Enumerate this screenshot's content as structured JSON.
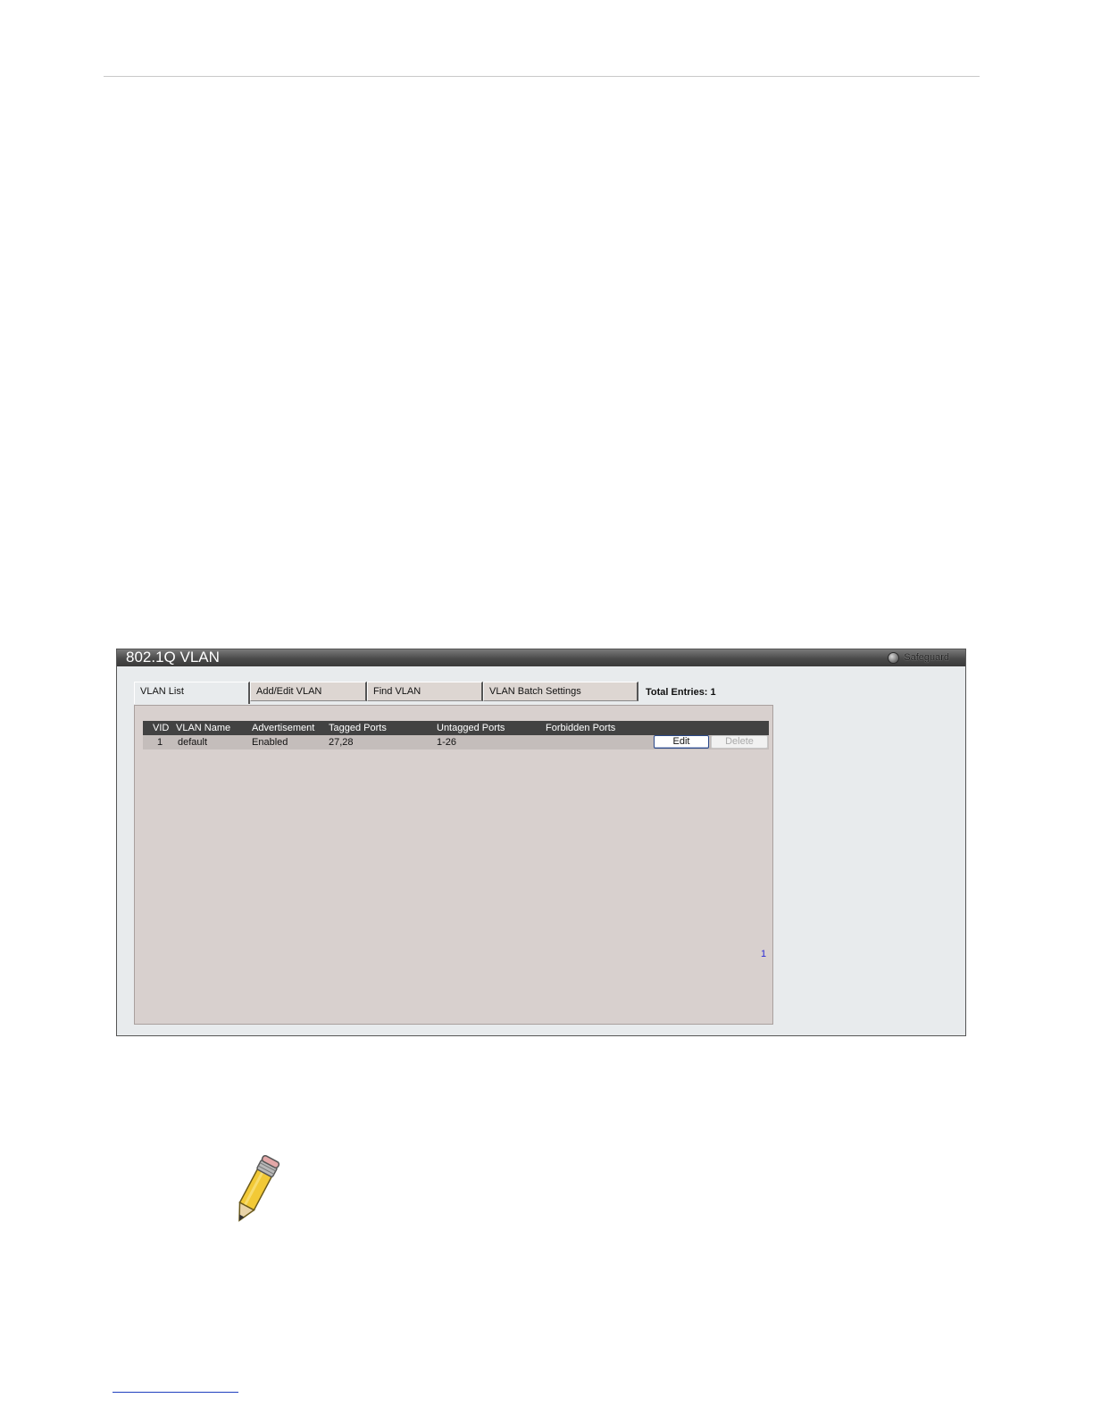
{
  "panel": {
    "title": "802.1Q VLAN",
    "safeguard_label": "Safeguard"
  },
  "tabs": [
    {
      "label": "VLAN List",
      "active": true
    },
    {
      "label": "Add/Edit VLAN",
      "active": false
    },
    {
      "label": "Find VLAN",
      "active": false
    },
    {
      "label": "VLAN Batch Settings",
      "active": false
    }
  ],
  "total_entries": "Total Entries: 1",
  "table": {
    "columns": [
      "VID",
      "VLAN Name",
      "Advertisement",
      "Tagged Ports",
      "Untagged Ports",
      "Forbidden Ports"
    ],
    "rows": [
      {
        "vid": "1",
        "vlan_name": "default",
        "advertisement": "Enabled",
        "tagged_ports": "27,28",
        "untagged_ports": "1-26",
        "forbidden_ports": "",
        "edit_label": "Edit",
        "delete_label": "Delete"
      }
    ]
  },
  "pager": {
    "pages": [
      "1"
    ]
  },
  "colors": {
    "title_bar": "#4a4a4a",
    "content_bg": "#d8d0ce",
    "link": "#2b2bd6"
  },
  "icons": {
    "note": "pencil-note-icon",
    "safeguard": "safeguard-indicator-icon"
  }
}
